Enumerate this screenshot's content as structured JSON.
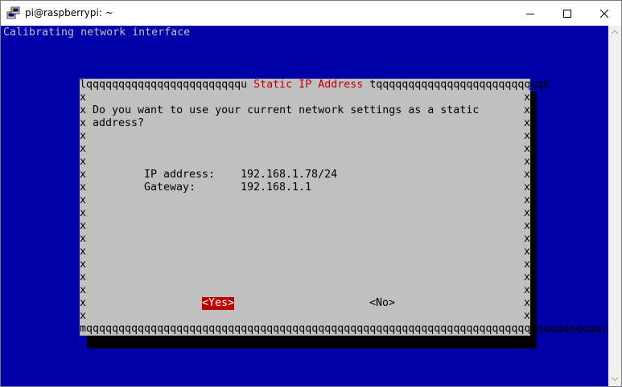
{
  "window": {
    "title": "pi@raspberrypi: ~",
    "app_icon": "putty-icon",
    "controls": {
      "minimize": "minimize-icon",
      "maximize": "maximize-icon",
      "close": "close-icon"
    }
  },
  "terminal": {
    "status_line": "Calibrating network interface",
    "colors": {
      "background": "#0000a8",
      "dialog": "#c0c0c0",
      "accent": "#c00000"
    }
  },
  "dialog": {
    "top_border_left": "lqqqqqqqqqqqqqqqqqqqqqqqqu",
    "title": " Static IP Address ",
    "top_border_right": "tqqqqqqqqqqqqqqqqqqqqqqqqqqk",
    "side_char": "x",
    "bottom_border": "mqqqqqqqqqqqqqqqqqqqqqqqqqqqqqqqqqqqqqqqqqqqqqqqqqqqqqqqqqqqqqqqqqqqqqqqqqqqqqqqqj",
    "question_line1": "Do you want to use your current network settings as a static",
    "question_line2": "address?",
    "ip_label": "IP address:",
    "ip_value": "192.168.1.78/24",
    "gateway_label": "Gateway:",
    "gateway_value": "192.168.1.1",
    "yes_button": "<Yes>",
    "no_button": "<No>"
  }
}
